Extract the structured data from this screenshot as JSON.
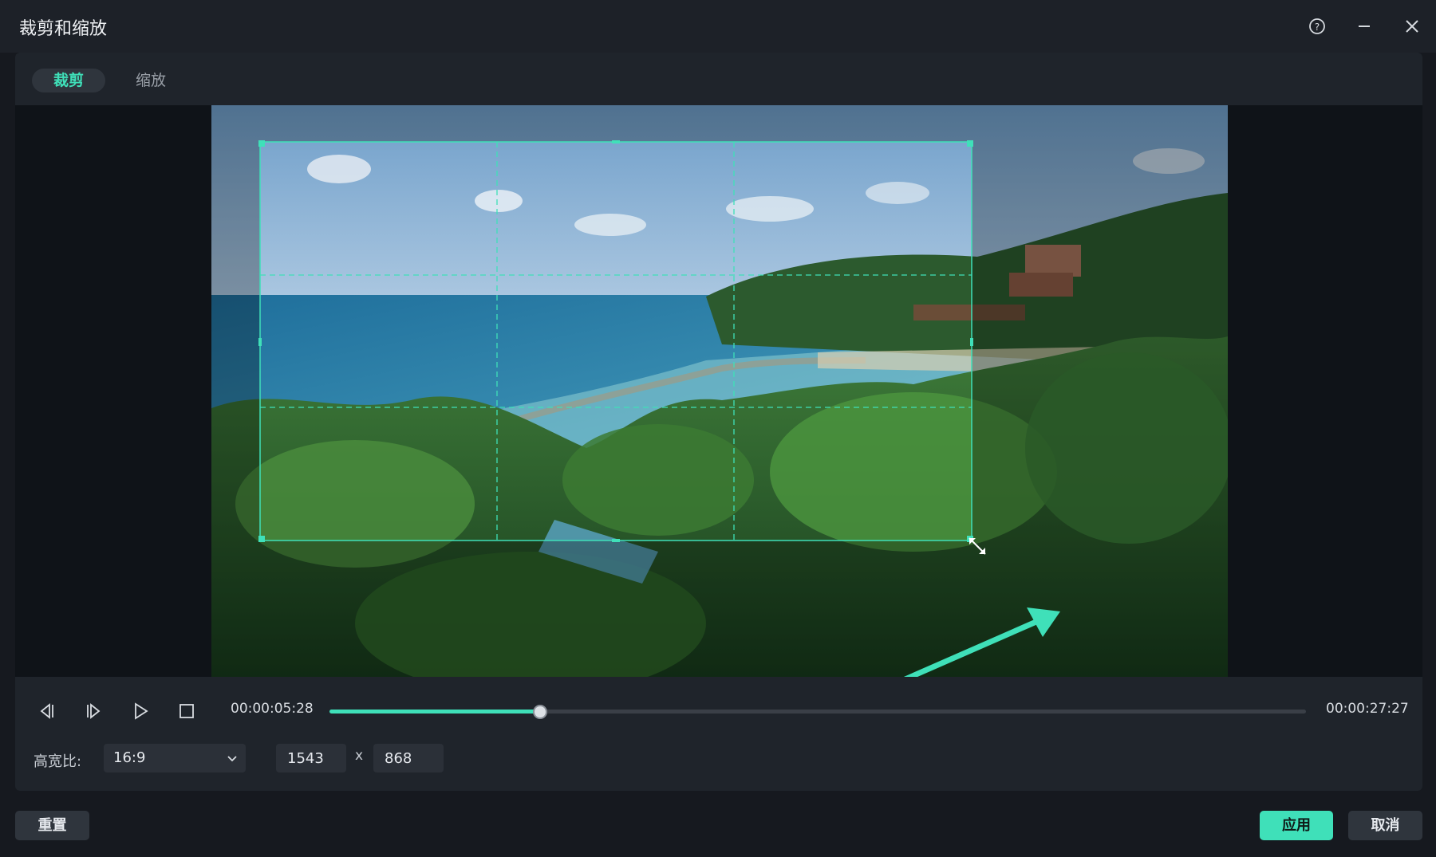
{
  "window": {
    "title": "裁剪和缩放",
    "help_icon": "help-circle-icon",
    "minimize_icon": "minimize-icon",
    "close_icon": "close-icon"
  },
  "tabs": [
    {
      "label": "裁剪",
      "active": true
    },
    {
      "label": "缩放",
      "active": false
    }
  ],
  "player": {
    "current_time": "00:00:05:28",
    "total_time": "00:00:27:27",
    "progress": 0.216,
    "icons": [
      "prev-frame-icon",
      "next-frame-icon",
      "play-icon",
      "stop-icon"
    ]
  },
  "crop": {
    "aspect_label": "高宽比:",
    "aspect_value": "16:9",
    "width": "1543",
    "separator": "x",
    "height": "868"
  },
  "buttons": {
    "reset": "重置",
    "apply": "应用",
    "cancel": "取消"
  },
  "colors": {
    "accent": "#3fe0b9",
    "background": "#16191f",
    "panel": "#1f242b"
  }
}
